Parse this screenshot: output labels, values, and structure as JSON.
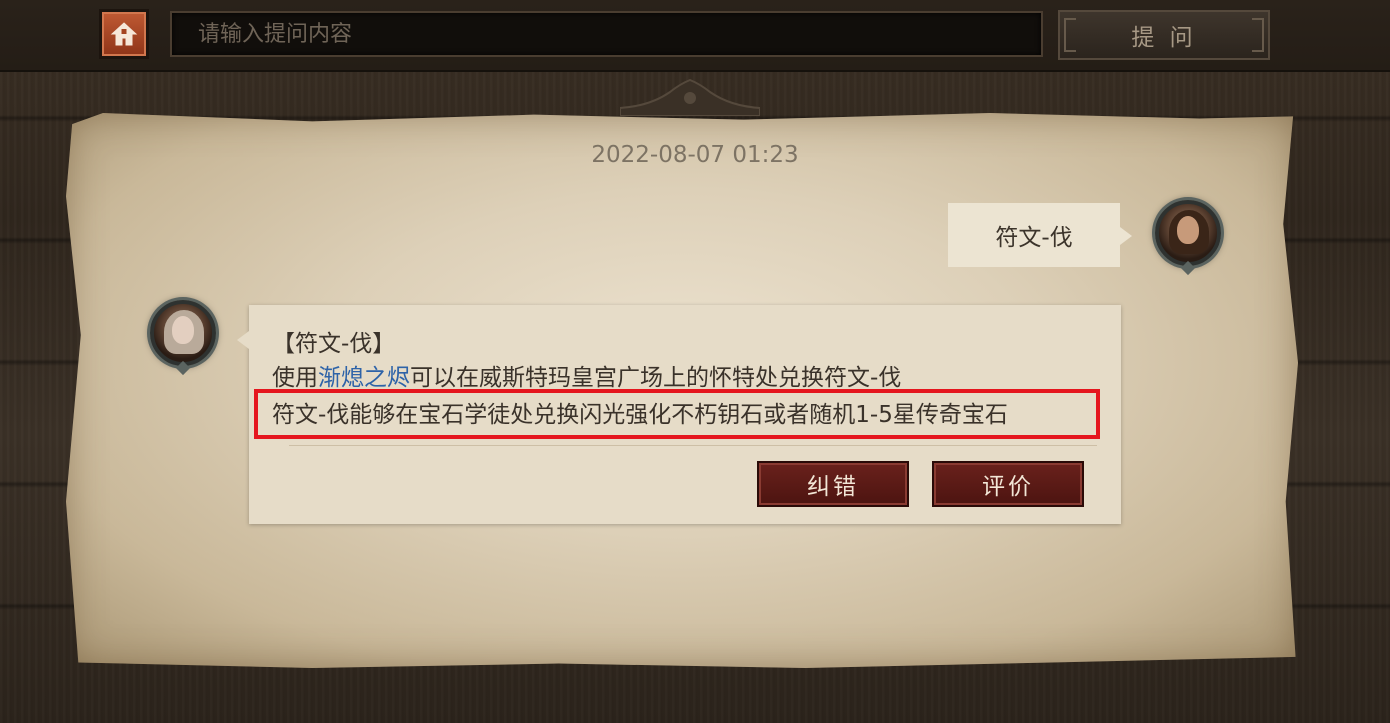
{
  "header": {
    "search_placeholder": "请输入提问内容",
    "ask_label": "提 问"
  },
  "chat": {
    "timestamp": "2022-08-07 01:23",
    "user_message": "符文-伐",
    "answer": {
      "title": "【符文-伐】",
      "line2_prefix": "使用",
      "line2_link": "渐熄之烬",
      "line2_suffix": "可以在威斯特玛皇宫广场上的怀特处兑换符文-伐",
      "line3": "符文-伐能够在宝石学徒处兑换闪光强化不朽钥石或者随机1-5星传奇宝石"
    },
    "buttons": {
      "correct": "纠错",
      "rate": "评价"
    }
  },
  "colors": {
    "link": "#2e63a8",
    "highlight": "#e5161e",
    "button_red": "#6a211c",
    "home_orange": "#c05a33"
  },
  "icons": {
    "home": "home-icon",
    "user_avatar": "user-avatar",
    "assistant_avatar": "assistant-avatar"
  }
}
